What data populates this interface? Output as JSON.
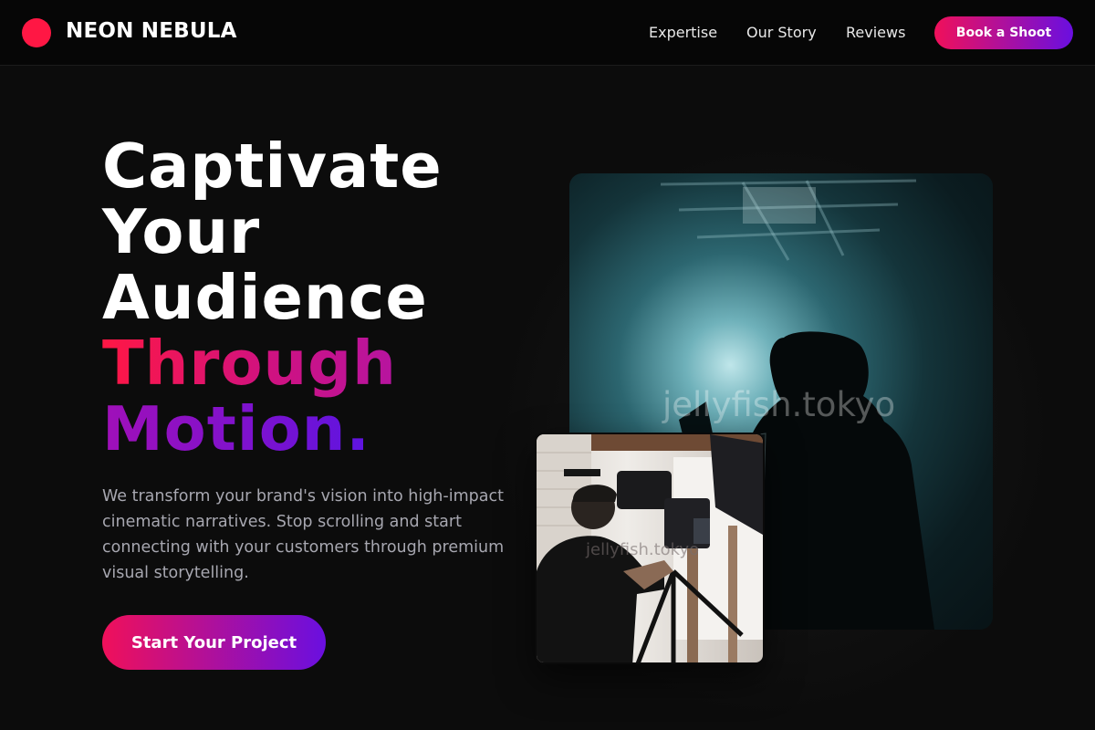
{
  "nav": {
    "brand": "NEON NEBULA",
    "links": [
      "Expertise",
      "Our Story",
      "Reviews"
    ],
    "cta": "Book a Shoot"
  },
  "hero": {
    "headline_lines": [
      "Captivate",
      "Your",
      "Audience"
    ],
    "headline_accent_1": "Through",
    "headline_accent_2": "Motion.",
    "subtext": "We transform your brand's vision into high-impact cinematic narratives. Stop scrolling and start connecting with your customers through premium visual storytelling.",
    "cta": "Start Your Project"
  },
  "media": {
    "main_watermark": "jellyfish.tokyo",
    "small_watermark": "jellyfish.tokyo"
  },
  "colors": {
    "accent_start": "#f0105a",
    "accent_end": "#6a0fe0",
    "logo_dot": "#ff1744",
    "background": "#0c0c0c"
  }
}
